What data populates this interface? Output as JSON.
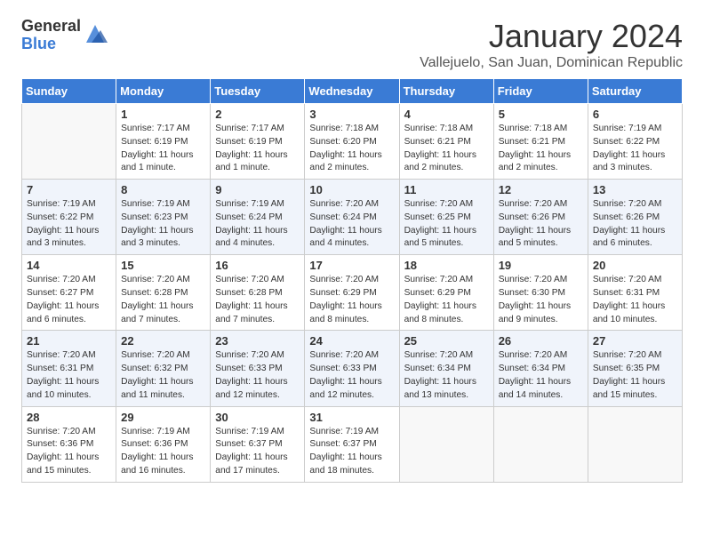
{
  "header": {
    "logo_general": "General",
    "logo_blue": "Blue",
    "month_title": "January 2024",
    "subtitle": "Vallejuelo, San Juan, Dominican Republic"
  },
  "weekdays": [
    "Sunday",
    "Monday",
    "Tuesday",
    "Wednesday",
    "Thursday",
    "Friday",
    "Saturday"
  ],
  "weeks": [
    [
      {
        "day": "",
        "content": ""
      },
      {
        "day": "1",
        "content": "Sunrise: 7:17 AM\nSunset: 6:19 PM\nDaylight: 11 hours and 1 minute."
      },
      {
        "day": "2",
        "content": "Sunrise: 7:17 AM\nSunset: 6:19 PM\nDaylight: 11 hours and 1 minute."
      },
      {
        "day": "3",
        "content": "Sunrise: 7:18 AM\nSunset: 6:20 PM\nDaylight: 11 hours and 2 minutes."
      },
      {
        "day": "4",
        "content": "Sunrise: 7:18 AM\nSunset: 6:21 PM\nDaylight: 11 hours and 2 minutes."
      },
      {
        "day": "5",
        "content": "Sunrise: 7:18 AM\nSunset: 6:21 PM\nDaylight: 11 hours and 2 minutes."
      },
      {
        "day": "6",
        "content": "Sunrise: 7:19 AM\nSunset: 6:22 PM\nDaylight: 11 hours and 3 minutes."
      }
    ],
    [
      {
        "day": "7",
        "content": "Sunrise: 7:19 AM\nSunset: 6:22 PM\nDaylight: 11 hours and 3 minutes."
      },
      {
        "day": "8",
        "content": "Sunrise: 7:19 AM\nSunset: 6:23 PM\nDaylight: 11 hours and 3 minutes."
      },
      {
        "day": "9",
        "content": "Sunrise: 7:19 AM\nSunset: 6:24 PM\nDaylight: 11 hours and 4 minutes."
      },
      {
        "day": "10",
        "content": "Sunrise: 7:20 AM\nSunset: 6:24 PM\nDaylight: 11 hours and 4 minutes."
      },
      {
        "day": "11",
        "content": "Sunrise: 7:20 AM\nSunset: 6:25 PM\nDaylight: 11 hours and 5 minutes."
      },
      {
        "day": "12",
        "content": "Sunrise: 7:20 AM\nSunset: 6:26 PM\nDaylight: 11 hours and 5 minutes."
      },
      {
        "day": "13",
        "content": "Sunrise: 7:20 AM\nSunset: 6:26 PM\nDaylight: 11 hours and 6 minutes."
      }
    ],
    [
      {
        "day": "14",
        "content": "Sunrise: 7:20 AM\nSunset: 6:27 PM\nDaylight: 11 hours and 6 minutes."
      },
      {
        "day": "15",
        "content": "Sunrise: 7:20 AM\nSunset: 6:28 PM\nDaylight: 11 hours and 7 minutes."
      },
      {
        "day": "16",
        "content": "Sunrise: 7:20 AM\nSunset: 6:28 PM\nDaylight: 11 hours and 7 minutes."
      },
      {
        "day": "17",
        "content": "Sunrise: 7:20 AM\nSunset: 6:29 PM\nDaylight: 11 hours and 8 minutes."
      },
      {
        "day": "18",
        "content": "Sunrise: 7:20 AM\nSunset: 6:29 PM\nDaylight: 11 hours and 8 minutes."
      },
      {
        "day": "19",
        "content": "Sunrise: 7:20 AM\nSunset: 6:30 PM\nDaylight: 11 hours and 9 minutes."
      },
      {
        "day": "20",
        "content": "Sunrise: 7:20 AM\nSunset: 6:31 PM\nDaylight: 11 hours and 10 minutes."
      }
    ],
    [
      {
        "day": "21",
        "content": "Sunrise: 7:20 AM\nSunset: 6:31 PM\nDaylight: 11 hours and 10 minutes."
      },
      {
        "day": "22",
        "content": "Sunrise: 7:20 AM\nSunset: 6:32 PM\nDaylight: 11 hours and 11 minutes."
      },
      {
        "day": "23",
        "content": "Sunrise: 7:20 AM\nSunset: 6:33 PM\nDaylight: 11 hours and 12 minutes."
      },
      {
        "day": "24",
        "content": "Sunrise: 7:20 AM\nSunset: 6:33 PM\nDaylight: 11 hours and 12 minutes."
      },
      {
        "day": "25",
        "content": "Sunrise: 7:20 AM\nSunset: 6:34 PM\nDaylight: 11 hours and 13 minutes."
      },
      {
        "day": "26",
        "content": "Sunrise: 7:20 AM\nSunset: 6:34 PM\nDaylight: 11 hours and 14 minutes."
      },
      {
        "day": "27",
        "content": "Sunrise: 7:20 AM\nSunset: 6:35 PM\nDaylight: 11 hours and 15 minutes."
      }
    ],
    [
      {
        "day": "28",
        "content": "Sunrise: 7:20 AM\nSunset: 6:36 PM\nDaylight: 11 hours and 15 minutes."
      },
      {
        "day": "29",
        "content": "Sunrise: 7:19 AM\nSunset: 6:36 PM\nDaylight: 11 hours and 16 minutes."
      },
      {
        "day": "30",
        "content": "Sunrise: 7:19 AM\nSunset: 6:37 PM\nDaylight: 11 hours and 17 minutes."
      },
      {
        "day": "31",
        "content": "Sunrise: 7:19 AM\nSunset: 6:37 PM\nDaylight: 11 hours and 18 minutes."
      },
      {
        "day": "",
        "content": ""
      },
      {
        "day": "",
        "content": ""
      },
      {
        "day": "",
        "content": ""
      }
    ]
  ]
}
